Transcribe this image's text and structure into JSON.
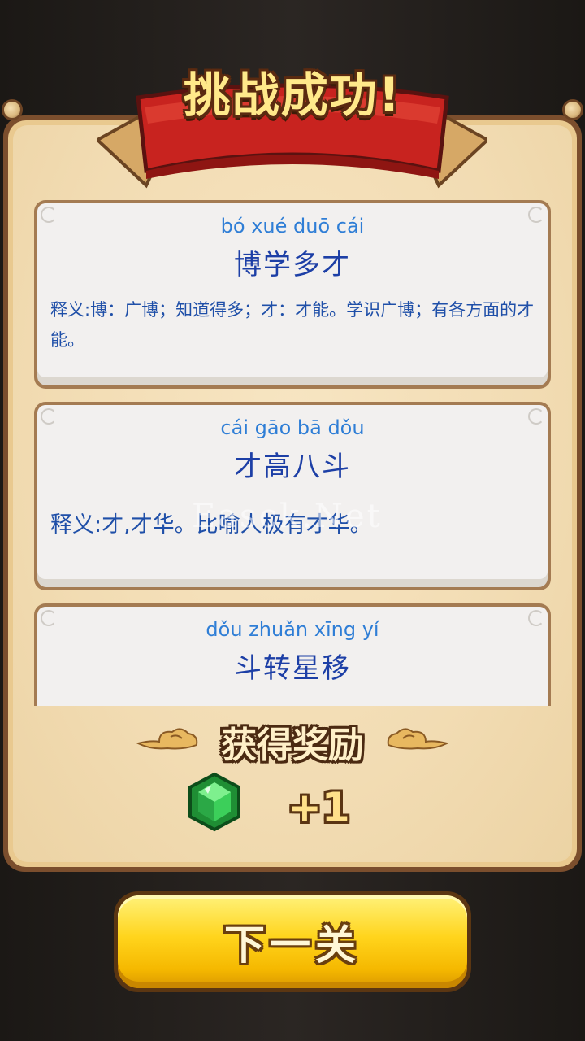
{
  "header": {
    "title": "挑战成功!"
  },
  "idioms": [
    {
      "pinyin": "bó xué duō cái",
      "idiom": "博学多才",
      "meaning": "释义:博：广博；知道得多；才：才能。学识广博；有各方面的才能。"
    },
    {
      "pinyin": "cái gāo bā dǒu",
      "idiom": "才高八斗",
      "meaning": "释义:才,才华。比喻人极有才华。"
    },
    {
      "pinyin": "dǒu zhuǎn xīng yí",
      "idiom": "斗转星移",
      "meaning": ""
    }
  ],
  "watermark": "Easck.Net",
  "reward": {
    "title": "获得奖励",
    "item_icon": "emerald-gem-icon",
    "amount": "+1"
  },
  "next_button": {
    "label": "下一关"
  },
  "colors": {
    "banner_red": "#c8231f",
    "parchment": "#f2dcb3",
    "pinyin_blue": "#2f7ed6",
    "idiom_blue": "#1d3fa6",
    "button_yellow": "#ffd41c",
    "gem_green": "#2fb34a"
  }
}
